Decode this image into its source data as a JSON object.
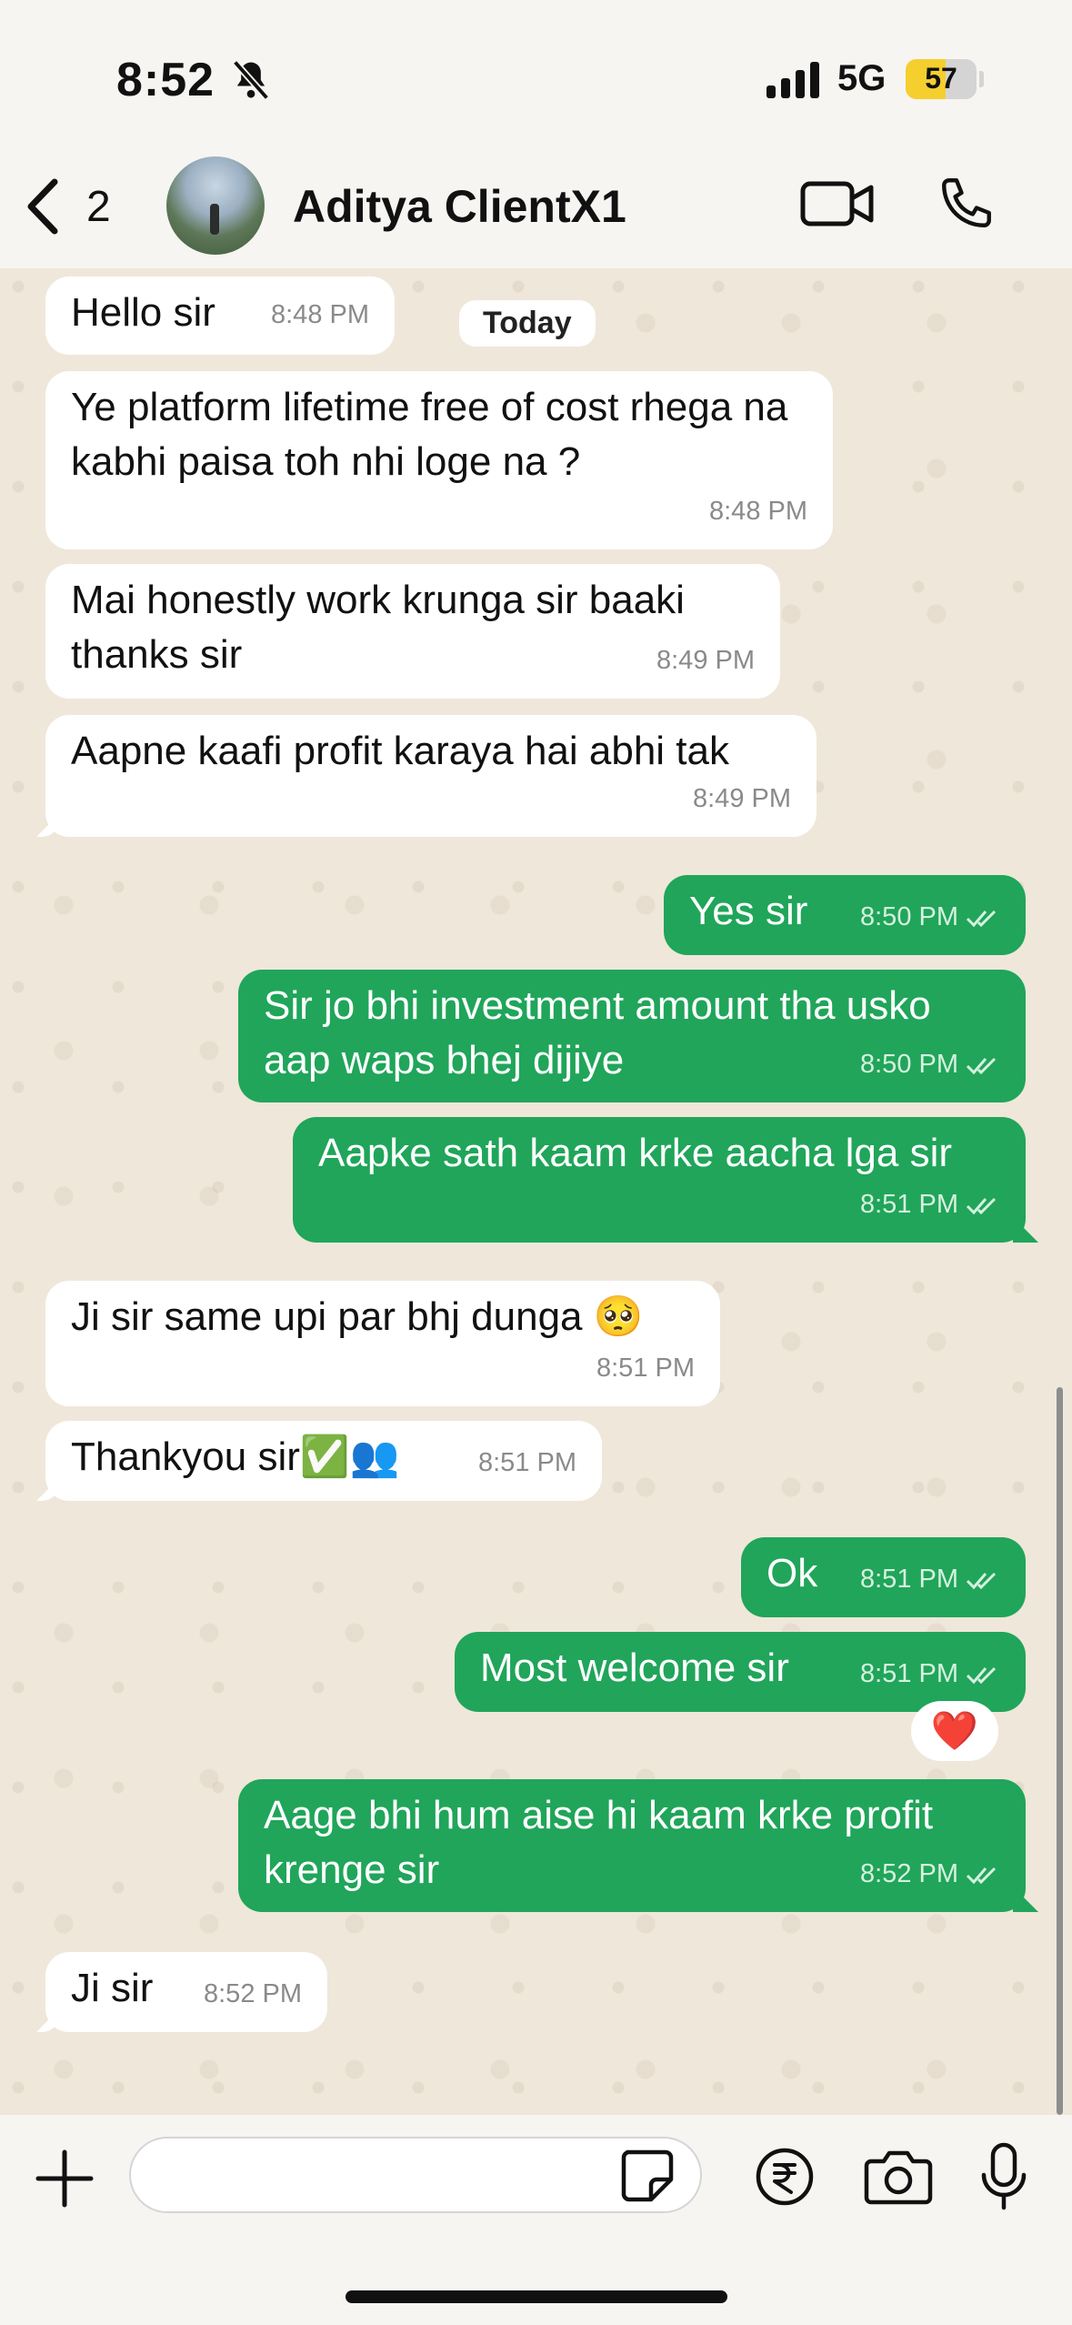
{
  "status_bar": {
    "time": "8:52",
    "network": "5G",
    "battery": "57"
  },
  "header": {
    "back_count": "2",
    "contact_name": "Aditya ClientX1"
  },
  "date_separator": "Today",
  "messages": [
    {
      "dir": "in",
      "text": "Hello sir",
      "time": "8:48 PM"
    },
    {
      "dir": "in",
      "text": "Ye platform lifetime free of cost rhega na kabhi paisa toh nhi loge na ?",
      "time": "8:48 PM"
    },
    {
      "dir": "in",
      "text": "Mai honestly work krunga sir baaki thanks sir",
      "time": "8:49 PM"
    },
    {
      "dir": "in",
      "text": "Aapne kaafi profit karaya hai abhi tak",
      "time": "8:49 PM"
    },
    {
      "dir": "out",
      "text": "Yes sir",
      "time": "8:50 PM"
    },
    {
      "dir": "out",
      "text": "Sir jo bhi investment amount tha usko aap waps bhej dijiye",
      "time": "8:50 PM"
    },
    {
      "dir": "out",
      "text": "Aapke sath kaam krke aacha lga sir",
      "time": "8:51 PM"
    },
    {
      "dir": "in",
      "text": "Ji sir same upi par bhj dunga 🥺",
      "time": "8:51 PM"
    },
    {
      "dir": "in",
      "text": "Thankyou sir✅👥",
      "time": "8:51 PM"
    },
    {
      "dir": "out",
      "text": "Ok",
      "time": "8:51 PM"
    },
    {
      "dir": "out",
      "text": "Most welcome sir",
      "time": "8:51 PM"
    },
    {
      "dir": "out",
      "text": "Aage bhi hum aise hi kaam krke profit krenge sir",
      "time": "8:52 PM"
    },
    {
      "dir": "in",
      "text": "Ji sir",
      "time": "8:52 PM"
    }
  ],
  "reaction": "❤️",
  "composer": {
    "placeholder": ""
  },
  "colors": {
    "outgoing": "#20a55a",
    "incoming": "#ffffff",
    "chat_bg": "#efe7da",
    "accent": "#20a55a"
  },
  "icons": [
    "bell-slash-icon",
    "signal-icon",
    "battery-icon",
    "back-chevron-icon",
    "video-call-icon",
    "phone-icon",
    "plus-icon",
    "sticker-icon",
    "rupee-icon",
    "camera-icon",
    "mic-icon",
    "read-ticks-icon"
  ]
}
